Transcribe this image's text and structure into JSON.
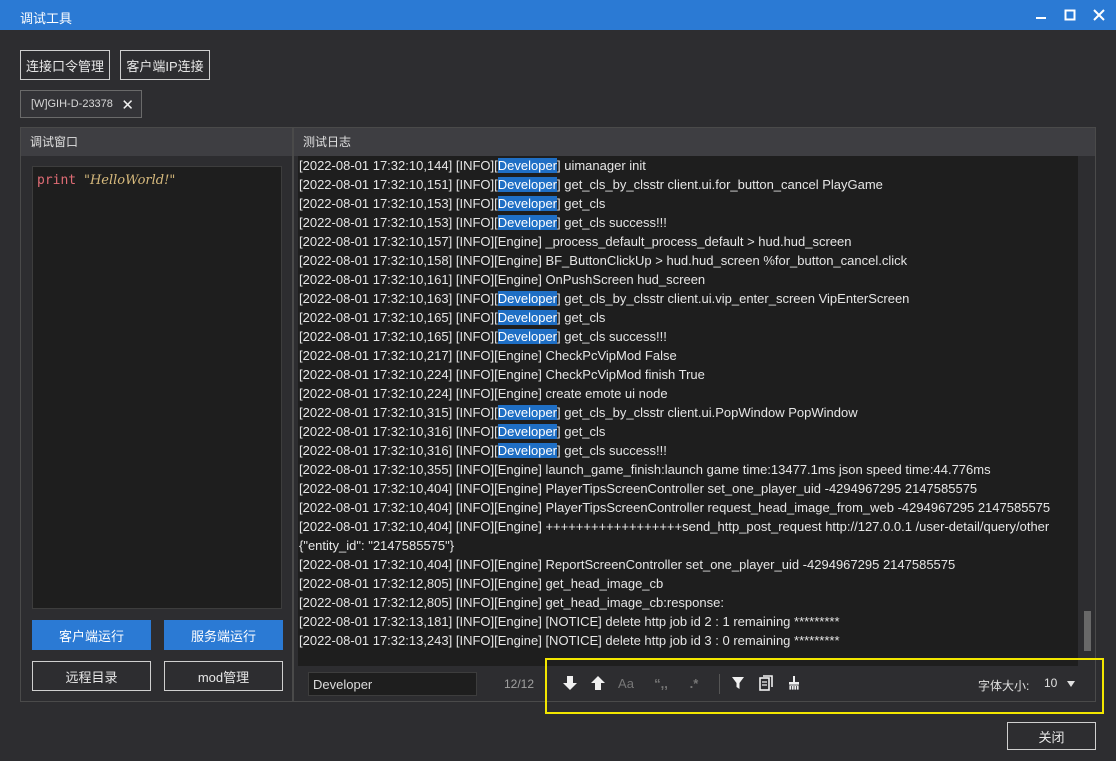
{
  "window": {
    "title": "调试工具"
  },
  "toolbar": {
    "conn_cmd_label": "连接口令管理",
    "client_ip_label": "客户端IP连接"
  },
  "session_tag": {
    "label": "[W]GIH-D-23378",
    "close_glyph": "✕"
  },
  "left_panel": {
    "header": "调试窗口",
    "code": {
      "keyword": "print",
      "string": "\"HelloWorld!\""
    },
    "buttons": {
      "client_run": "客户端运行",
      "server_run": "服务端运行",
      "remote_dir": "远程目录",
      "mod_manage": "mod管理"
    }
  },
  "right_panel": {
    "header": "测试日志",
    "log_lines": [
      {
        "pre": "[2022-08-01 17:32:10,144] [INFO][",
        "hl": "Developer",
        "post": "] uimanager init"
      },
      {
        "pre": "[2022-08-01 17:32:10,151] [INFO][",
        "hl": "Developer",
        "post": "] get_cls_by_clsstr client.ui.for_button_cancel PlayGame"
      },
      {
        "pre": "[2022-08-01 17:32:10,153] [INFO][",
        "hl": "Developer",
        "post": "] get_cls"
      },
      {
        "pre": "[2022-08-01 17:32:10,153] [INFO][",
        "hl": "Developer",
        "post": "] get_cls success!!!"
      },
      {
        "pre": "[2022-08-01 17:32:10,157] [INFO][Engine] _process_default_process_default > hud.hud_screen",
        "hl": "",
        "post": ""
      },
      {
        "pre": "[2022-08-01 17:32:10,158] [INFO][Engine] BF_ButtonClickUp > hud.hud_screen %for_button_cancel.click",
        "hl": "",
        "post": ""
      },
      {
        "pre": "[2022-08-01 17:32:10,161] [INFO][Engine] OnPushScreen hud_screen",
        "hl": "",
        "post": ""
      },
      {
        "pre": "[2022-08-01 17:32:10,163] [INFO][",
        "hl": "Developer",
        "post": "] get_cls_by_clsstr client.ui.vip_enter_screen VipEnterScreen"
      },
      {
        "pre": "[2022-08-01 17:32:10,165] [INFO][",
        "hl": "Developer",
        "post": "] get_cls"
      },
      {
        "pre": "[2022-08-01 17:32:10,165] [INFO][",
        "hl": "Developer",
        "post": "] get_cls success!!!"
      },
      {
        "pre": "[2022-08-01 17:32:10,217] [INFO][Engine] CheckPcVipMod False",
        "hl": "",
        "post": ""
      },
      {
        "pre": "[2022-08-01 17:32:10,224] [INFO][Engine] CheckPcVipMod finish True",
        "hl": "",
        "post": ""
      },
      {
        "pre": "[2022-08-01 17:32:10,224] [INFO][Engine] create emote ui node",
        "hl": "",
        "post": ""
      },
      {
        "pre": "[2022-08-01 17:32:10,315] [INFO][",
        "hl": "Developer",
        "post": "] get_cls_by_clsstr client.ui.PopWindow PopWindow"
      },
      {
        "pre": "[2022-08-01 17:32:10,316] [INFO][",
        "hl": "Developer",
        "post": "] get_cls"
      },
      {
        "pre": "[2022-08-01 17:32:10,316] [INFO][",
        "hl": "Developer",
        "post": "] get_cls success!!!"
      },
      {
        "pre": "[2022-08-01 17:32:10,355] [INFO][Engine] launch_game_finish:launch game time:13477.1ms json speed time:44.776ms",
        "hl": "",
        "post": ""
      },
      {
        "pre": "[2022-08-01 17:32:10,404] [INFO][Engine] PlayerTipsScreenController set_one_player_uid -4294967295 2147585575",
        "hl": "",
        "post": ""
      },
      {
        "pre": "[2022-08-01 17:32:10,404] [INFO][Engine] PlayerTipsScreenController request_head_image_from_web -4294967295 2147585575",
        "hl": "",
        "post": ""
      },
      {
        "pre": "[2022-08-01 17:32:10,404] [INFO][Engine] ++++++++++++++++++send_http_post_request http://127.0.0.1 /user-detail/query/other {\"entity_id\": \"2147585575\"}",
        "hl": "",
        "post": ""
      },
      {
        "pre": "[2022-08-01 17:32:10,404] [INFO][Engine] ReportScreenController set_one_player_uid -4294967295 2147585575",
        "hl": "",
        "post": ""
      },
      {
        "pre": "[2022-08-01 17:32:12,805] [INFO][Engine] get_head_image_cb",
        "hl": "",
        "post": ""
      },
      {
        "pre": "[2022-08-01 17:32:12,805] [INFO][Engine] get_head_image_cb:response:",
        "hl": "",
        "post": ""
      },
      {
        "pre": "[2022-08-01 17:32:13,181] [INFO][Engine] [NOTICE] delete http job id 2 : 1 remaining *********",
        "hl": "",
        "post": ""
      },
      {
        "pre": "[2022-08-01 17:32:13,243] [INFO][Engine] [NOTICE] delete http job id 3 : 0 remaining *********",
        "hl": "",
        "post": ""
      }
    ],
    "search": {
      "value": "Developer",
      "count": "12/12"
    },
    "tools": [
      "arrow-down-icon",
      "arrow-up-icon",
      "match-case-icon",
      "match-word-icon",
      "regex-icon",
      "filter-icon",
      "copy-icon",
      "clear-icon"
    ],
    "tool_glyphs": {
      "match_case": "Aa",
      "match_word": "“,,",
      "regex": ".*"
    },
    "font_size": {
      "label": "字体大小:",
      "value": "10"
    }
  },
  "footer": {
    "close_label": "关闭"
  },
  "colors": {
    "titlebar": "#2b7ad4",
    "accent": "#2b7ad4",
    "highlight_box": "#f2e600",
    "log_highlight": "#1f6fc5"
  }
}
